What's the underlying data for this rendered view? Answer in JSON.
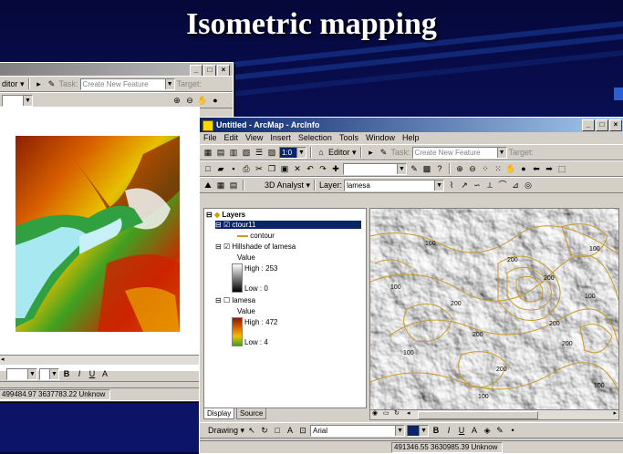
{
  "slide": {
    "title": "Isometric mapping"
  },
  "colors": {
    "background": "#0b1468",
    "title_bar": "#0a246a",
    "contour": "#c89a2a"
  },
  "left_window": {
    "toolbar": {
      "editor_label": "ditor ▾",
      "task_label": "Task:",
      "task_value": "Create New Feature",
      "target_label": "Target:"
    },
    "font_bar": {
      "bold": "B",
      "italic": "I",
      "underline": "U",
      "text_color": "A"
    },
    "status": {
      "coords": "499484.97  3637783.22 Unknow"
    }
  },
  "right_window": {
    "title": "Untitled - ArcMap - ArcInfo",
    "window_buttons": [
      "_",
      "□",
      "×"
    ],
    "menus": [
      "File",
      "Edit",
      "View",
      "Insert",
      "Selection",
      "Tools",
      "Window",
      "Help"
    ],
    "toolbar": {
      "zoom_value": "1:0",
      "editor_label": "Editor ▾",
      "task_label": "Task:",
      "task_value": "Create New Feature",
      "target_label": "Target:"
    },
    "analyst_bar": {
      "analyst_label": "3D Analyst ▾",
      "layer_label": "Layer:",
      "layer_value": "lamesa"
    },
    "toc": {
      "root": "Layers",
      "items": [
        {
          "name": "ctour11",
          "legend": "contour"
        },
        {
          "name": "Hillshade of lamesa",
          "value_label": "Value",
          "high": "High : 253",
          "low": "Low : 0"
        },
        {
          "name": "lamesa",
          "value_label": "Value",
          "high": "High : 472",
          "low": "Low : 4"
        }
      ],
      "tabs": [
        "Display",
        "Source"
      ]
    },
    "contour_labels": [
      "100",
      "100",
      "100",
      "200",
      "200",
      "200",
      "200",
      "200",
      "100",
      "100",
      "100",
      "100",
      "200",
      "200"
    ],
    "drawing_bar": {
      "drawing_label": "Drawing ▾",
      "font_value": "Arial",
      "bold": "B",
      "italic": "I",
      "underline": "U",
      "text_color": "A"
    },
    "status": {
      "coords": "491346.55  3630985.39 Unknow"
    }
  }
}
